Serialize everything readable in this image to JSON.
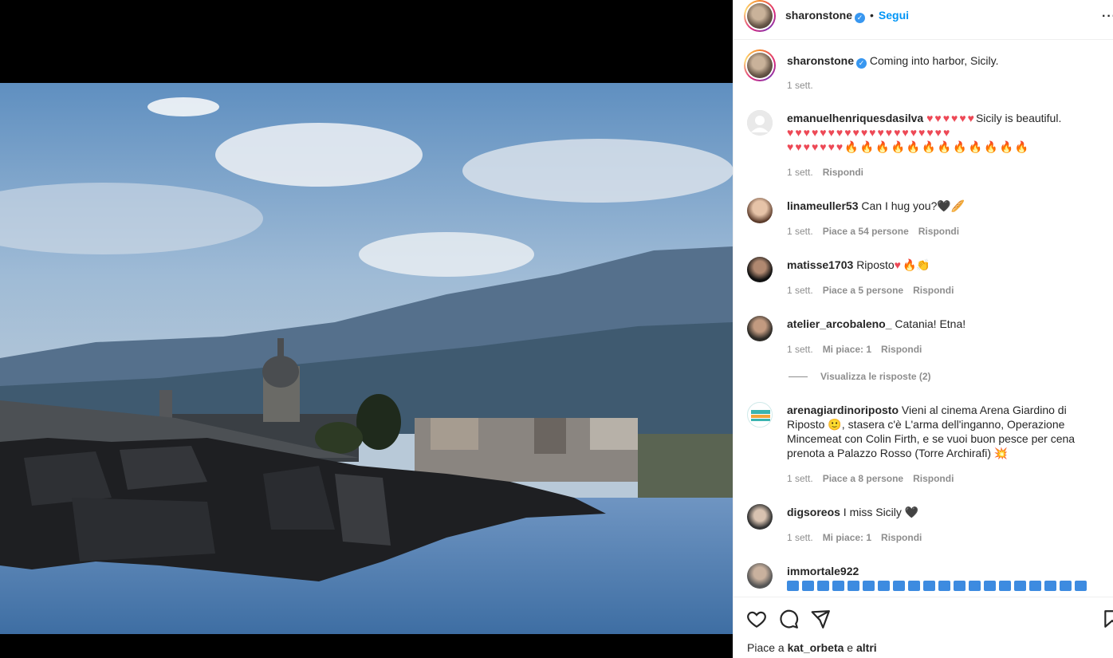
{
  "post": {
    "username": "sharonstone",
    "follow_label": "Segui",
    "caption": "Coming into harbor, Sicily.",
    "caption_time": "1 sett."
  },
  "comments": [
    {
      "user": "emanuelhenriquesdasilva",
      "time": "1 sett.",
      "reply": "Rispondi"
    },
    {
      "user": "linameuller53",
      "text": "Can I hug you?",
      "time": "1 sett.",
      "likes": "Piace a 54 persone",
      "reply": "Rispondi"
    },
    {
      "user": "matisse1703",
      "text": "Riposto",
      "time": "1 sett.",
      "likes": "Piace a 5 persone",
      "reply": "Rispondi"
    },
    {
      "user": "atelier_arcobaleno_",
      "text": "Catania! Etna!",
      "time": "1 sett.",
      "likes": "Mi piace: 1",
      "reply": "Rispondi",
      "view_replies": "Visualizza le risposte (2)"
    },
    {
      "user": "arenagiardinoriposto",
      "text": "Vieni al cinema Arena Giardino di Riposto 🙂, stasera c'è L'arma dell'inganno, Operazione Mincemeat con Colin Firth, e se vuoi buon pesce per cena prenota a Palazzo Rosso (Torre Archirafi) 💥",
      "time": "1 sett.",
      "likes": "Piace a 8 persone",
      "reply": "Rispondi"
    },
    {
      "user": "digsoreos",
      "text": "I miss Sicily 🖤",
      "time": "1 sett.",
      "likes": "Mi piace: 1",
      "reply": "Rispondi"
    },
    {
      "user": "immortale922"
    }
  ],
  "comment0_text": "Sicily is beautiful.",
  "footer": {
    "likes_prefix": "Piace a",
    "likes_user": "kat_orbeta",
    "likes_join": "e",
    "likes_others": "altri"
  },
  "icons": {
    "like": "heart-icon",
    "comment": "comment-icon",
    "share": "share-icon",
    "save": "bookmark-icon",
    "more": "more-icon"
  },
  "colors": {
    "accent": "#0095f6",
    "verified": "#3897f0",
    "muted": "#8e8e8e"
  }
}
